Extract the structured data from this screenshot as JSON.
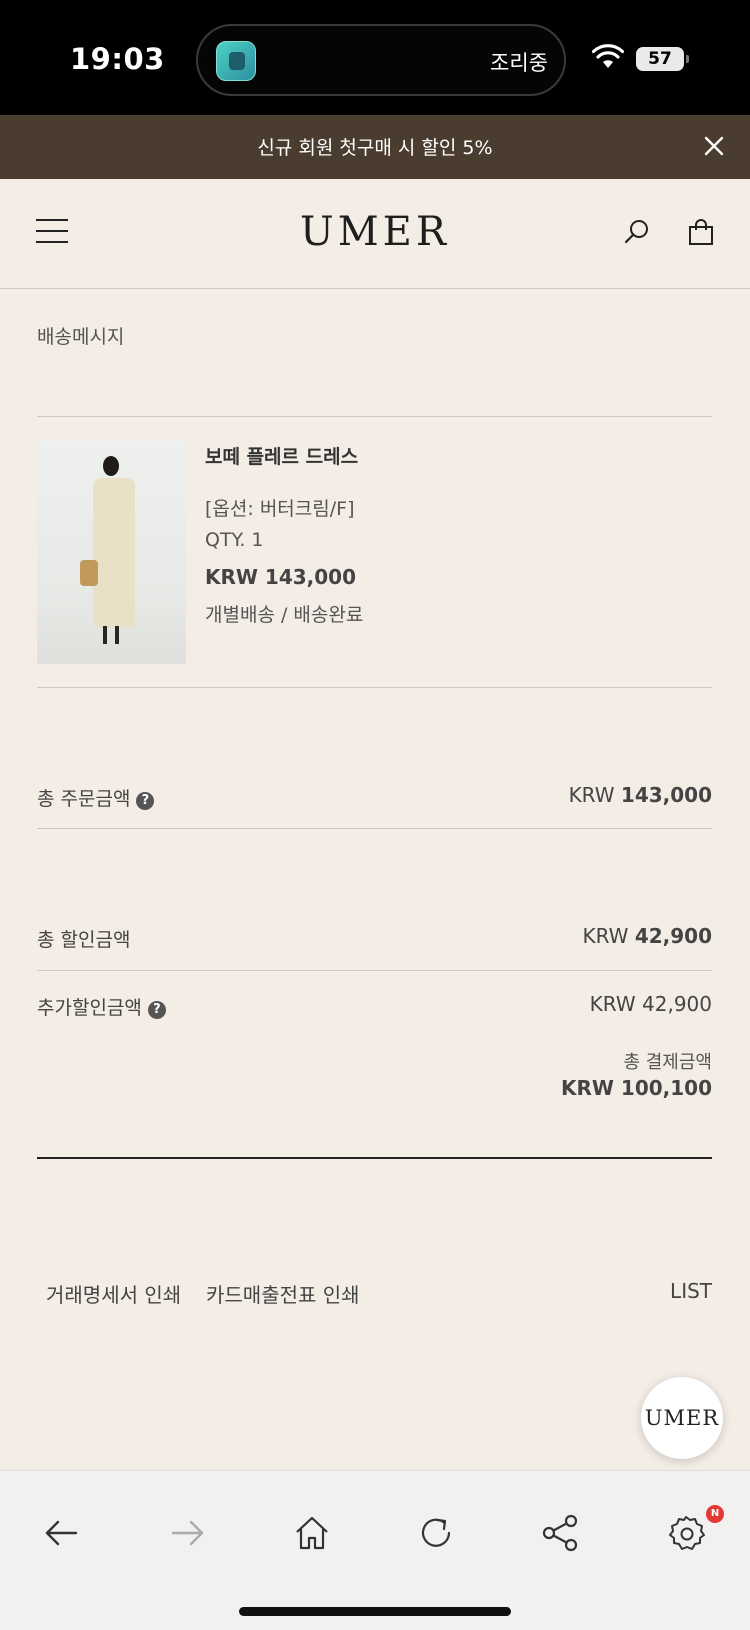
{
  "status_bar": {
    "time": "19:03",
    "activity": "조리중",
    "battery": "57"
  },
  "promo_banner": {
    "text": "신규 회원 첫구매 시 할인 5%"
  },
  "header": {
    "logo": "UMER"
  },
  "delivery_message": {
    "label": "배송메시지"
  },
  "product": {
    "name": "보떼 플레르 드레스",
    "option": "[옵션: 버터크림/F]",
    "qty": "QTY. 1",
    "price": "KRW 143,000",
    "status": "개별배송 / 배송완료"
  },
  "summary": {
    "order_total_label": "총 주문금액",
    "order_total_currency": "KRW",
    "order_total_amount": "143,000",
    "discount_label": "총 할인금액",
    "discount_currency": "KRW",
    "discount_amount": "42,900",
    "extra_discount_label": "추가할인금액",
    "extra_discount_value": "KRW 42,900",
    "payment_label": "총 결제금액",
    "payment_value": "KRW 100,100"
  },
  "links": {
    "receipt": "거래명세서 인쇄",
    "card_slip": "카드매출전표 인쇄",
    "list": "LIST"
  },
  "fab": {
    "label": "UMER"
  },
  "browser": {
    "notification_badge": "N"
  },
  "colors": {
    "background": "#f4ede6",
    "promo_bar": "#4a3d2f",
    "text": "#333333",
    "divider": "#cfc6bc",
    "badge": "#e53935"
  }
}
